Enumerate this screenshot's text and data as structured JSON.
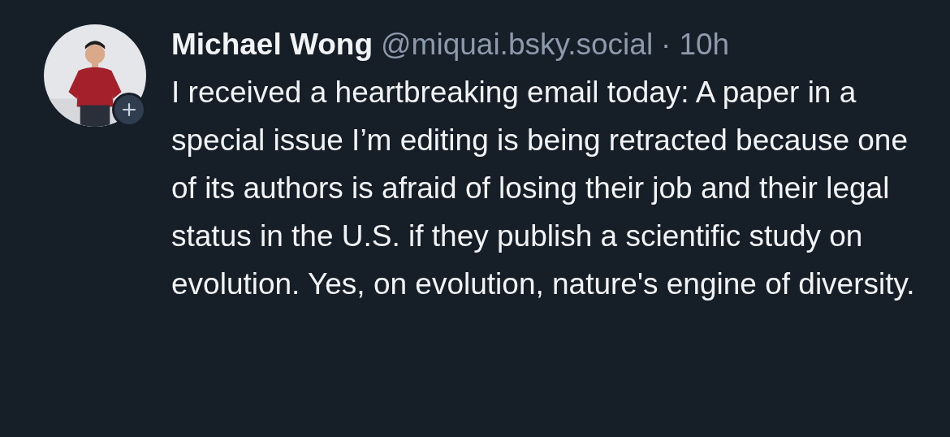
{
  "post": {
    "author": "Michael Wong",
    "handle": "@miquai.bsky.social",
    "separator": "·",
    "time": "10h",
    "text": "I received a heartbreaking email today: A paper in a special issue I’m editing is being retracted because one of its authors is afraid of losing their job and their legal status in the U.S. if they publish a scientific study on evolution. Yes, on evolution, nature's engine of diversity."
  }
}
